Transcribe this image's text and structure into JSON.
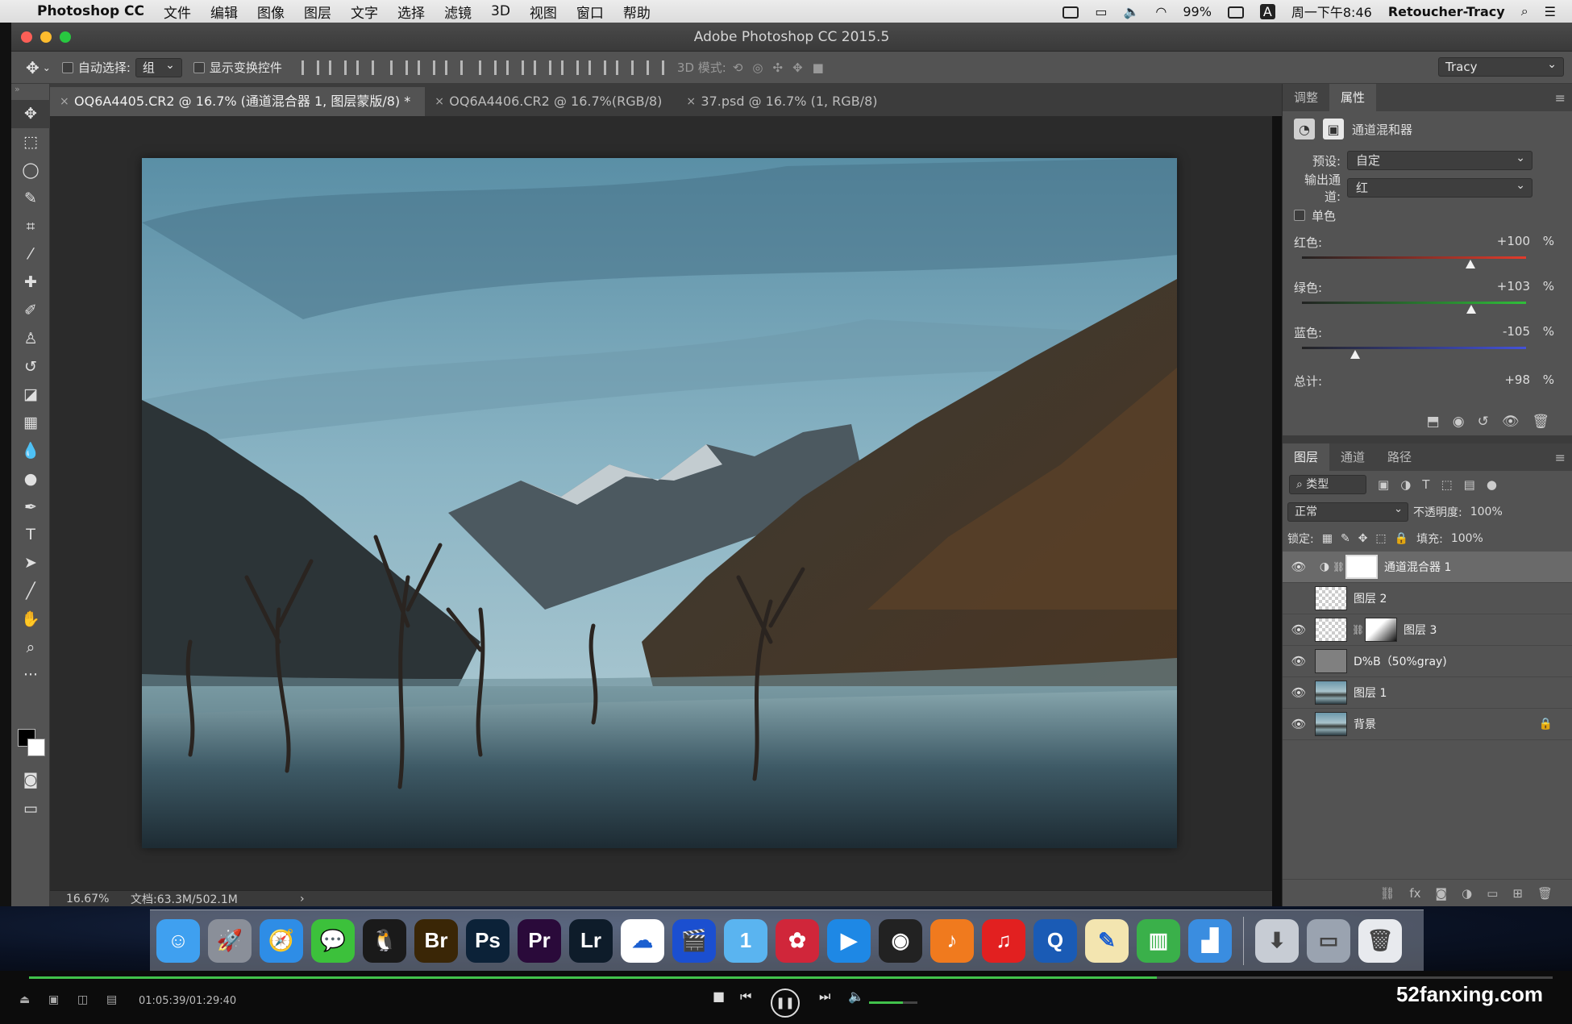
{
  "menubar": {
    "app": "Photoshop CC",
    "items": [
      "文件",
      "编辑",
      "图像",
      "图层",
      "文字",
      "选择",
      "滤镜",
      "3D",
      "视图",
      "窗口",
      "帮助"
    ],
    "battery": "99%",
    "input_method": "A",
    "datetime": "周一下午8:46",
    "user": "Retoucher-Tracy"
  },
  "window": {
    "title": "Adobe Photoshop CC 2015.5"
  },
  "options": {
    "auto_select_label": "自动选择:",
    "auto_select_value": "组",
    "show_transform_label": "显示变换控件",
    "mode3d_label": "3D 模式:",
    "workspace": "Tracy"
  },
  "tabs": [
    {
      "label": "OQ6A4405.CR2 @ 16.7% (通道混合器 1, 图层蒙版/8) *",
      "active": true
    },
    {
      "label": "OQ6A4406.CR2 @ 16.7%(RGB/8)",
      "active": false
    },
    {
      "label": "37.psd @ 16.7% (1, RGB/8)",
      "active": false
    }
  ],
  "status": {
    "zoom": "16.67%",
    "doc": "文档:63.3M/502.1M"
  },
  "properties": {
    "tabs": [
      "调整",
      "属性"
    ],
    "active_tab": "属性",
    "title": "通道混和器",
    "preset_label": "预设:",
    "preset_value": "自定",
    "output_label": "输出通道:",
    "output_value": "红",
    "mono_label": "单色",
    "sliders": [
      {
        "name": "红色:",
        "value": "+100",
        "pct": "%",
        "level": 0.75,
        "color": "#e33b2b"
      },
      {
        "name": "绿色:",
        "value": "+103",
        "pct": "%",
        "level": 0.755,
        "color": "#2fbf3a"
      },
      {
        "name": "蓝色:",
        "value": "-105",
        "pct": "%",
        "level": 0.238,
        "color": "#4452d8"
      }
    ],
    "total_label": "总计:",
    "total_value": "+98",
    "total_pct": "%"
  },
  "layers_panel": {
    "tabs": [
      "图层",
      "通道",
      "路径"
    ],
    "filter": "类型",
    "blend_mode": "正常",
    "opacity_label": "不透明度:",
    "opacity": "100%",
    "lock_label": "锁定:",
    "fill_label": "填充:",
    "fill": "100%",
    "layers": [
      {
        "name": "通道混合器 1",
        "visible": true,
        "selected": true
      },
      {
        "name": "图层 2",
        "visible": false,
        "selected": false
      },
      {
        "name": "图层 3",
        "visible": true,
        "selected": false
      },
      {
        "name": "D%B（50%gray)",
        "visible": true,
        "selected": false
      },
      {
        "name": "图层 1",
        "visible": true,
        "selected": false
      },
      {
        "name": "背景",
        "visible": true,
        "selected": false
      }
    ]
  },
  "dock": {
    "apps": [
      {
        "name": "finder-icon",
        "label": "",
        "color": "#3fa0f0"
      },
      {
        "name": "launchpad-icon",
        "label": "",
        "color": "#8a8f99"
      },
      {
        "name": "safari-icon",
        "label": "",
        "color": "#2e8de6"
      },
      {
        "name": "wechat-icon",
        "label": "",
        "color": "#3cc13b"
      },
      {
        "name": "qq-icon",
        "label": "",
        "color": "#1a1a1a"
      },
      {
        "name": "bridge-icon",
        "label": "Br",
        "color": "#3a2606"
      },
      {
        "name": "photoshop-icon",
        "label": "Ps",
        "color": "#0c2238"
      },
      {
        "name": "premiere-icon",
        "label": "Pr",
        "color": "#2a0a3a"
      },
      {
        "name": "lightroom-icon",
        "label": "Lr",
        "color": "#0e1c2a"
      },
      {
        "name": "baidu-netdisk-icon",
        "label": "",
        "color": "#ffffff"
      },
      {
        "name": "video-app-icon",
        "label": "",
        "color": "#1b4fd0"
      },
      {
        "name": "1password-icon",
        "label": "1",
        "color": "#5ab4f0"
      },
      {
        "name": "davinci-icon",
        "label": "",
        "color": "#d0263a"
      },
      {
        "name": "player-icon",
        "label": "",
        "color": "#1e88e5"
      },
      {
        "name": "obs-icon",
        "label": "",
        "color": "#222222"
      },
      {
        "name": "xiami-icon",
        "label": "",
        "color": "#f07a1e"
      },
      {
        "name": "netease-music-icon",
        "label": "",
        "color": "#e22020"
      },
      {
        "name": "quicktime-icon",
        "label": "",
        "color": "#1a5bb5"
      },
      {
        "name": "textedit-icon",
        "label": "",
        "color": "#f3e5b0"
      },
      {
        "name": "numbers-icon",
        "label": "",
        "color": "#3ab04a"
      },
      {
        "name": "keynote-icon",
        "label": "",
        "color": "#3a8de0"
      }
    ],
    "utilities": [
      {
        "name": "downloads-folder-icon",
        "color": "#c7ccd4"
      },
      {
        "name": "screen-capture-icon",
        "color": "#9aa3b0"
      },
      {
        "name": "trash-icon",
        "color": "#e8eaee"
      }
    ]
  },
  "player": {
    "time": "01:05:39/01:29:40",
    "progress": 0.74,
    "volume": 0.7,
    "watermark": "52fanxing.com"
  },
  "colors": {
    "accent_green": "#41c24b",
    "panel_bg": "#535353",
    "canvas_bg": "#2b2b2b"
  }
}
